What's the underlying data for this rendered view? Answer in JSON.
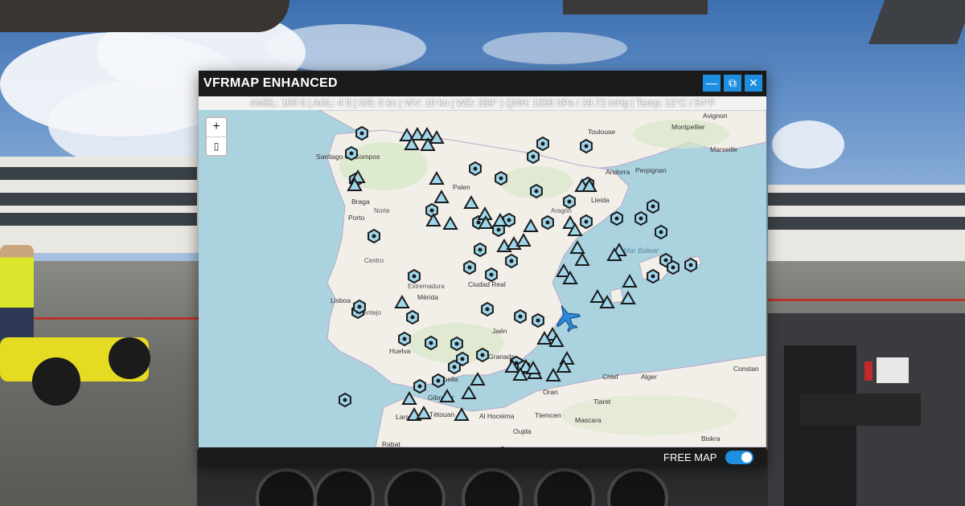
{
  "window": {
    "title": "VFRMAP ENHANCED",
    "minimize_glyph": "—",
    "popout_glyph": "⧉",
    "close_glyph": "✕"
  },
  "status": {
    "line": "AMSL: 100 ft | AGL: 4 ft | GS: 0 kn | WV: 10 kn | WD: 280° | QNH: 1006 hPa / 29.72 inHg | Temp: 12°C / 54°F"
  },
  "map": {
    "zoom_in": "+",
    "zoom_out": "▯",
    "labels": {
      "toulouse": "Toulouse",
      "montpellier": "Montpellier",
      "avignon": "Avignon",
      "marseille": "Marseille",
      "perpignan": "Perpignan",
      "andorra": "Andorra",
      "lleida": "Lleida",
      "santiago": "Santiago de Compos",
      "braga": "Braga",
      "porto": "Porto",
      "lisboa": "Lisboa",
      "palencia": "Palen",
      "mar_balear": "Mar Balear",
      "merida": "Mérida",
      "ciudad_real": "Ciudad Real",
      "huelva": "Huelva",
      "granada": "Granada",
      "marbella": "Marbella",
      "gibraltar": "Gibraltar",
      "al_hoceima": "Al Hoceima",
      "tetouan": "Tétouan",
      "oran": "Oran",
      "chlef": "Chlef",
      "alger": "Alger",
      "tiaret": "Tiaret",
      "tlemcen": "Tlemcen",
      "mascara": "Mascara",
      "rabat": "Rabat",
      "biskra": "Biskra",
      "constantine": "Constan",
      "larache": "Larache",
      "oujda": "Oujda",
      "jaen": "Jaén",
      "alentejo": "Alentejo",
      "extremadura": "Extremadura",
      "norte": "Norte",
      "centro": "Centro",
      "aragon": "Aragón"
    }
  },
  "bottom": {
    "free_map_label": "FREE MAP",
    "free_map_on": true
  },
  "colors": {
    "accent": "#1e8fe0",
    "sea": "#aad3df",
    "land": "#f2efe9",
    "airport_fill": "#9fd6ea",
    "airport_stroke": "#1a1a1a",
    "plane": "#2b8ae0"
  },
  "icons": {
    "airport_marker": "hexagon-airport-icon",
    "heliport_marker": "triangle-airfield-icon",
    "aircraft": "airplane-icon"
  }
}
